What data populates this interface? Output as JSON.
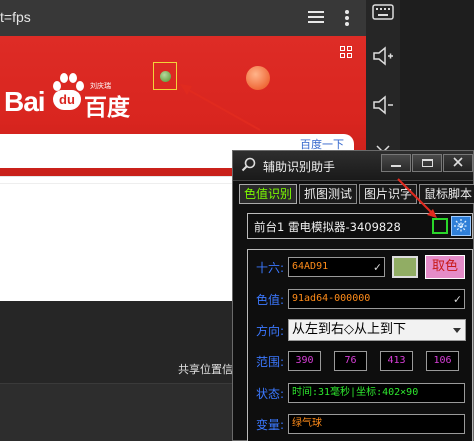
{
  "browser": {
    "address_text": "t=fps",
    "share_text": "共享位置信",
    "search_button": "百度一下"
  },
  "baidu_logo": {
    "text_left": "Bai",
    "text_du": "du",
    "text_cn": "百度",
    "small_text": "刘庆瑞"
  },
  "emulator_sidebar": {
    "buttons": [
      "keyboard-icon",
      "volume-up-icon",
      "volume-down-icon",
      "collapse-icon"
    ]
  },
  "helper": {
    "title": "辅助识别助手",
    "tabs": [
      {
        "label": "色值识别",
        "active": true
      },
      {
        "label": "抓图测试",
        "active": false
      },
      {
        "label": "图片识字",
        "active": false
      },
      {
        "label": "鼠标脚本",
        "active": false
      }
    ],
    "target_window": "前台1  雷电模拟器-3409828",
    "hex_label": "十六:",
    "hex_value": "64AD91",
    "pick_button": "取色",
    "color_value_label": "色值:",
    "color_value": "91ad64-000000",
    "direction_label": "方向:",
    "direction_value": "从左到右◇从上到下",
    "range_label": "范围:",
    "range_values": [
      "390",
      "76",
      "413",
      "106"
    ],
    "status_label": "状态:",
    "status_value": "时间:31毫秒|坐标:402×90",
    "variable_label": "变量:",
    "variable_value": "绿气球",
    "swatch_color": "#91ad64"
  },
  "colors": {
    "baidu_red": "#d9251f",
    "accent_green": "#2ad52a",
    "label_blue": "#3b78ff",
    "field_orange": "#ff8c1a",
    "range_magenta": "#d83fd8"
  }
}
